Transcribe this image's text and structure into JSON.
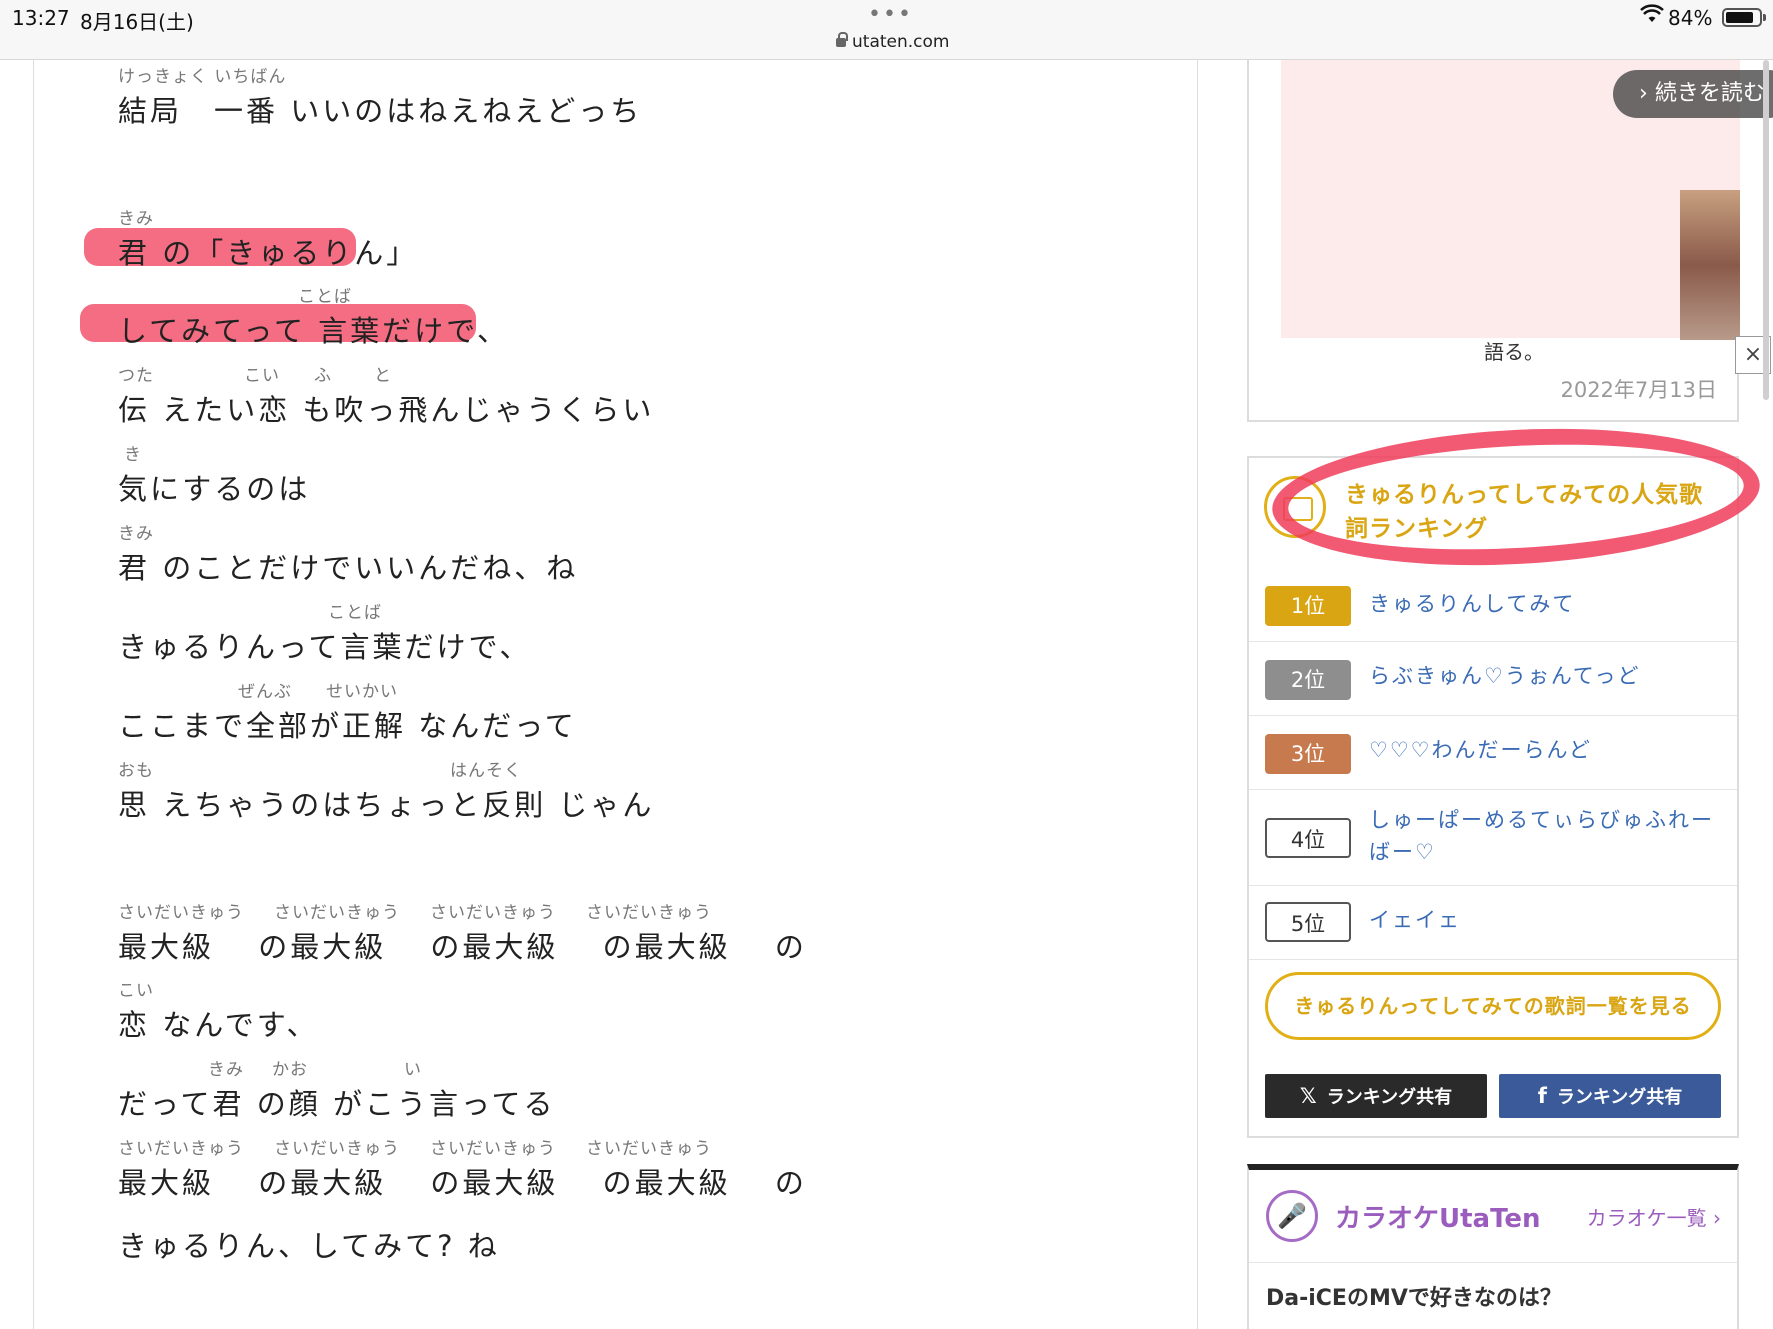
{
  "status_bar": {
    "time": "13:27",
    "date": "8月16日(土)",
    "dots": "•••",
    "url": "utaten.com",
    "battery_text": "84%",
    "battery_level": 0.84
  },
  "lyrics": {
    "l1": {
      "ruby": "けっきょく いちばん",
      "text": "結局　一番  いいのはねえねえどっち"
    },
    "l2": {
      "ruby": "きみ",
      "text": "君 の「きゅるりん」"
    },
    "l3": {
      "ruby": "ことば",
      "text": "してみてって 言葉だけで、"
    },
    "l4": {
      "ruby1": "つた",
      "ruby2": "こい",
      "ruby3": "ふ",
      "ruby4": "と",
      "text": "伝 えたい恋 も吹っ飛んじゃうくらい"
    },
    "l5": {
      "ruby": "き",
      "text": "気にするのは"
    },
    "l6": {
      "ruby": "きみ",
      "text": "君 のことだけでいいんだね、ね"
    },
    "l7": {
      "ruby": "ことば",
      "text": "きゅるりんって言葉だけで、"
    },
    "l8": {
      "ruby1": "ぜんぶ",
      "ruby2": "せいかい",
      "text": "ここまで全部が正解  なんだって"
    },
    "l9": {
      "ruby1": "おも",
      "ruby2": "はんそく",
      "text": "思 えちゃうのはちょっと反則  じゃん"
    },
    "l10": {
      "ruby1": "さいだいきゅう",
      "ruby2": "さいだいきゅう",
      "ruby3": "さいだいきゅう",
      "ruby4": "さいだいきゅう",
      "text": "最大級　 の最大級　 の最大級　 の最大級　  の"
    },
    "l11": {
      "ruby": "こい",
      "text": "恋 なんです、"
    },
    "l12": {
      "ruby1": "きみ",
      "ruby2": "かお",
      "ruby3": "い",
      "text": "だって君 の顔 がこう言ってる"
    },
    "l13": {
      "ruby1": "さいだいきゅう",
      "ruby2": "さいだいきゅう",
      "ruby3": "さいだいきゅう",
      "ruby4": "さいだいきゅう",
      "text": "最大級　 の最大級　 の最大級　 の最大級　  の"
    },
    "l14": {
      "text": "きゅるりん、してみて? ね"
    }
  },
  "article": {
    "read_more": "続きを読む",
    "text": "語る。",
    "date": "2022年7月13日",
    "close": "×"
  },
  "ranking": {
    "title": "きゅるりんってしてみての人気歌詞ランキング",
    "items": [
      {
        "rank": "1位",
        "name": "きゅるりんしてみて",
        "color": "#d9a512"
      },
      {
        "rank": "2位",
        "name": "らぶきゅん♡うぉんてっど",
        "color": "#8e8e8e"
      },
      {
        "rank": "3位",
        "name": "♡♡♡わんだーらんど",
        "color": "#c77a4e"
      },
      {
        "rank": "4位",
        "name": "しゅーぱーめるてぃらびゅふれーばー♡"
      },
      {
        "rank": "5位",
        "name": "イェイェ"
      }
    ],
    "list_button": "きゅるりんってしてみての歌詞一覧を見る",
    "share_x_icon": "𝕏",
    "share_x": "ランキング共有",
    "share_fb_icon": "f",
    "share_fb": "ランキング共有"
  },
  "karaoke": {
    "title": "カラオケUtaTen",
    "link": "カラオケ一覧 ›",
    "question": "Da-iCEのMVで好きなのは？"
  }
}
